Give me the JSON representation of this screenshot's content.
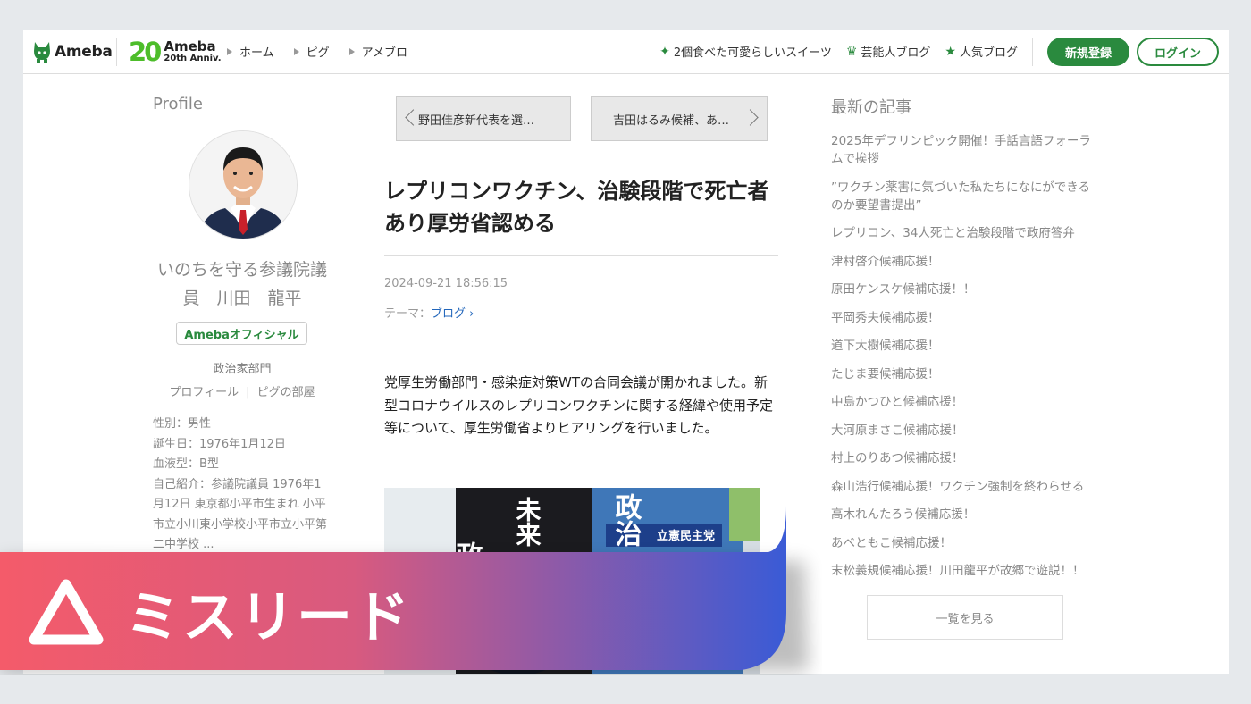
{
  "header": {
    "logo": "Ameba",
    "anniversary": {
      "number": "20",
      "brand": "Ameba",
      "sub": "20th Anniv."
    },
    "nav": [
      "ホーム",
      "ピグ",
      "アメブロ"
    ],
    "right_links": [
      {
        "icon": "sparkle-icon",
        "label": "2個食べた可愛らしいスイーツ"
      },
      {
        "icon": "crown-icon",
        "label": "芸能人ブログ"
      },
      {
        "icon": "star-icon",
        "label": "人気ブログ"
      }
    ],
    "register_label": "新規登録",
    "login_label": "ログイン",
    "accent": "#2a8a3e"
  },
  "profile": {
    "label": "Profile",
    "name_line1": "いのちを守る参議院議",
    "name_line2": "員　川田　龍平",
    "official_badge": "Amebaオフィシャル",
    "category": "政治家部門",
    "link_profile": "プロフィール",
    "link_pig": "ピグの部屋",
    "gender": "性別：男性",
    "birthday": "誕生日：1976年1月12日",
    "blood": "血液型：B型",
    "bio": "自己紹介：参議院議員 1976年1月12日 東京都小平市生まれ 小平市立小川東小学校小平市立小平第二中学校 ..."
  },
  "article": {
    "prev_title": "野田佳彦新代表を選…",
    "next_title": "吉田はるみ候補、あ…",
    "title": "レプリコンワクチン、治験段階で死亡者あり厚労省認める",
    "date": "2024-09-21 18:56:15",
    "theme_label": "テーマ：",
    "theme_link": "ブログ",
    "body": "党厚生労働部門・感染症対策WTの合同会議が開かれました。新型コロナウイルスのレプリコンワクチンに関する経緯や使用予定等について、厚生労働省よりヒアリングを行いました。",
    "photo_text": {
      "left": "政治",
      "middle": "未来へ",
      "right": "政治へ",
      "party": "立憲民主党"
    }
  },
  "sidebar": {
    "title": "最新の記事",
    "items": [
      "2025年デフリンピック開催！手話言語フォーラムで挨拶",
      "”ワクチン薬害に気づいた私たちになにができるのか要望書提出”",
      "レプリコン、34人死亡と治験段階で政府答弁",
      "津村啓介候補応援！",
      "原田ケンスケ候補応援！！",
      "平岡秀夫候補応援！",
      "道下大樹候補応援！",
      "たじま要候補応援！",
      "中島かつひと候補応援！",
      "大河原まさこ候補応援！",
      "村上のりあつ候補応援！",
      "森山浩行候補応援！ワクチン強制を終わらせる",
      "高木れんたろう候補応援！",
      "あべともこ候補応援！",
      "末松義規候補応援！川田龍平が故郷で遊説！！"
    ],
    "more_label": "一覧を見る"
  },
  "banner": {
    "label": "ミスリード",
    "color_start": "#f45b6a",
    "color_end": "#3a5bd6"
  }
}
